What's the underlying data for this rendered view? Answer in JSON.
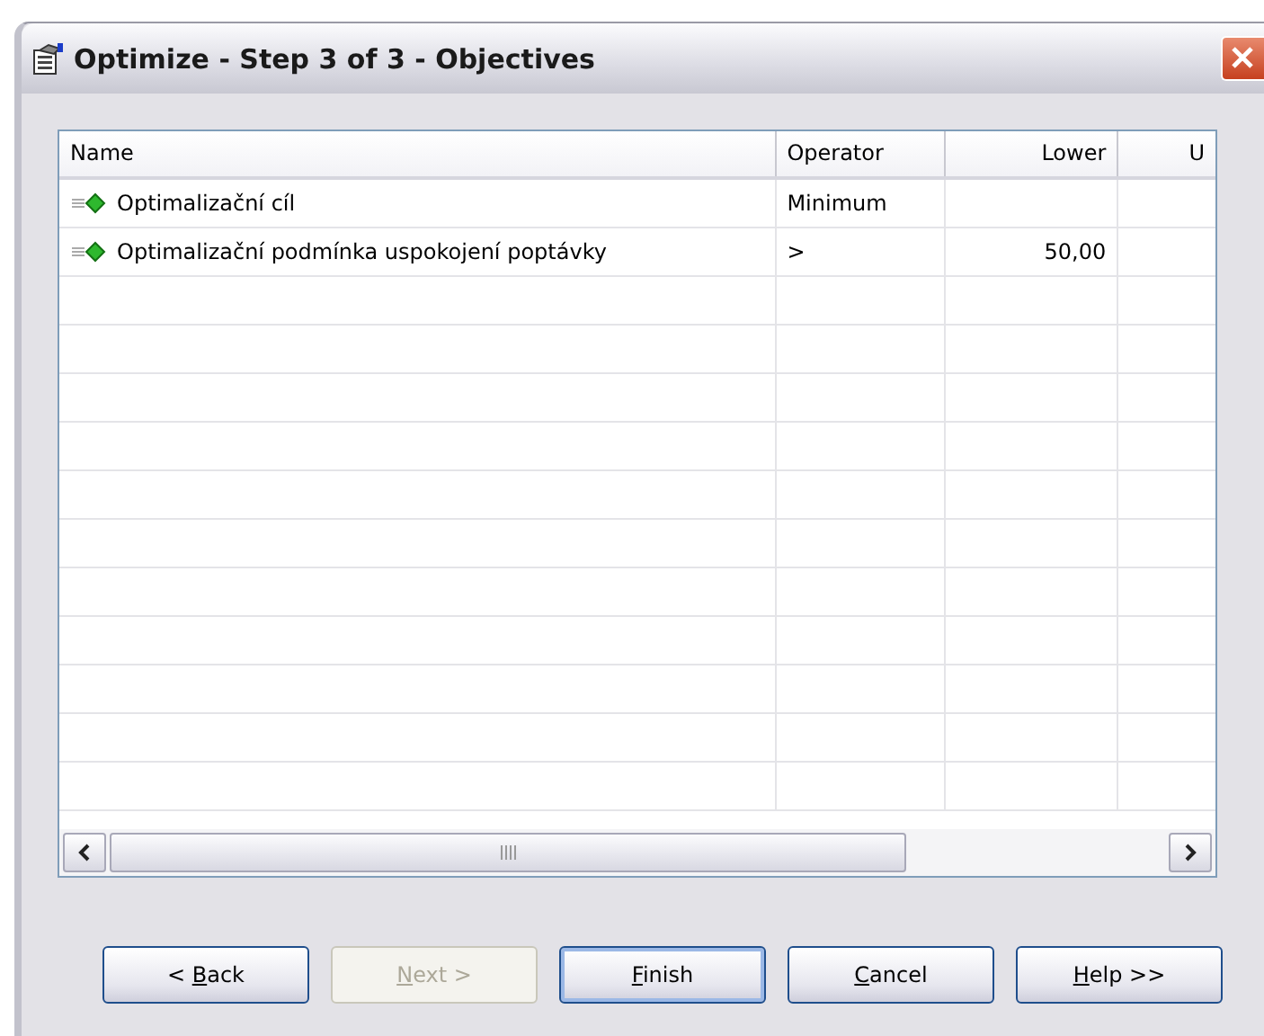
{
  "window": {
    "title": "Optimize - Step 3 of 3 - Objectives"
  },
  "table": {
    "columns": [
      {
        "label": "Name"
      },
      {
        "label": "Operator"
      },
      {
        "label": "Lower"
      },
      {
        "label": "U"
      }
    ],
    "rows": [
      {
        "cells": [
          "Optimalizační cíl",
          "Minimum",
          "",
          ""
        ]
      },
      {
        "cells": [
          "Optimalizační podmínka uspokojení poptávky",
          ">",
          "50,00",
          ""
        ]
      }
    ]
  },
  "buttons": [
    {
      "before": "< ",
      "key": "B",
      "after": "ack",
      "disabled": false,
      "default": false
    },
    {
      "key": "N",
      "after": "ext >",
      "disabled": true,
      "default": false
    },
    {
      "key": "F",
      "after": "inish",
      "disabled": false,
      "default": true
    },
    {
      "key": "C",
      "after": "ancel",
      "disabled": false,
      "default": false
    },
    {
      "key": "H",
      "after": "elp >>",
      "disabled": false,
      "default": false
    }
  ]
}
